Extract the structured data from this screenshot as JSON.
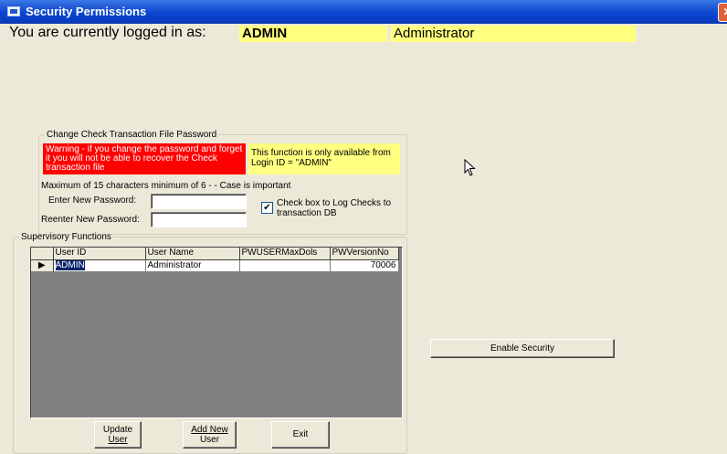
{
  "window": {
    "title": "Security Permissions",
    "close_glyph": "✕"
  },
  "login": {
    "label": "You are currently logged in as:",
    "user_id": "ADMIN",
    "user_name": "Administrator"
  },
  "password_section": {
    "legend": "Change Check Transaction File Password",
    "warning_text": "Warning - if you change the password and forget it you will not be able to recover the Check transaction file",
    "info_text": "This function is only available from Login ID = \"ADMIN\"",
    "rule_text": "Maximum of 15 characters minimum of 6 - -  Case is important",
    "new_password_label": "Enter New Password:",
    "new_password_value": "",
    "reenter_password_label": "Reenter New Password:",
    "reenter_password_value": "",
    "log_checks_label": "Check box to Log Checks to transaction DB",
    "log_checks_checked": true,
    "check_glyph": "✔"
  },
  "supervisory": {
    "legend": "Supervisory Functions",
    "columns": [
      "User ID",
      "User Name",
      "PWUSERMaxDols",
      "PWVersionNo"
    ],
    "rows": [
      {
        "indicator": "▶",
        "user_id": "ADMIN",
        "user_name": "Administrator",
        "max_dols": "",
        "version_no": "70006"
      }
    ],
    "buttons": {
      "update_line1": "Update",
      "update_line2": "User",
      "add_line1": "Add New",
      "add_line2": "User",
      "exit": "Exit"
    }
  },
  "enable_security_label": "Enable Security",
  "colors": {
    "titlebar": "#0A46D0",
    "warning_bg": "#FF0000",
    "highlight_bg": "#FFFF80",
    "window_bg": "#ECE9D8"
  }
}
